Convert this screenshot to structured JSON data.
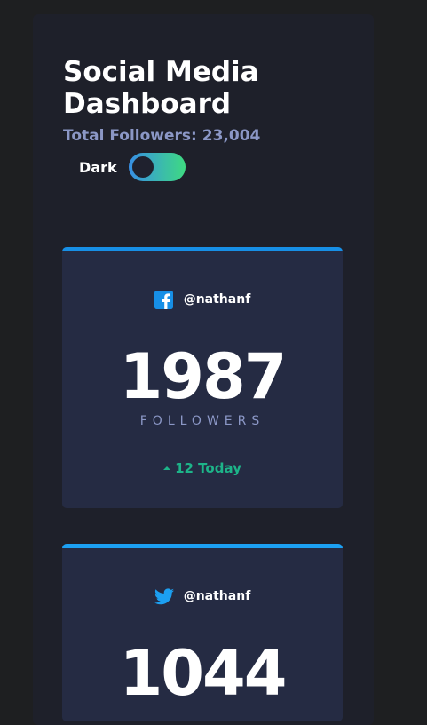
{
  "header": {
    "title": "Social Media Dashboard",
    "total_followers": "Total Followers: 23,004",
    "theme_toggle_label": "Dark"
  },
  "cards": [
    {
      "network": "facebook",
      "icon": "facebook-icon",
      "accent_color": "#178fe6",
      "handle": "@nathanf",
      "count": "1987",
      "count_label": "FOLLOWERS",
      "today_change": "12 Today",
      "today_trend": "up"
    },
    {
      "network": "twitter",
      "icon": "twitter-icon",
      "accent_color": "#1ca0f2",
      "handle": "@nathanf",
      "count": "1044"
    }
  ],
  "colors": {
    "page_background": "#1e1f21",
    "panel_background": "#1e202a",
    "card_background": "#252b43",
    "muted_text": "#8b97c6",
    "positive": "#1db489",
    "toggle_gradient_start": "#378fe6",
    "toggle_gradient_end": "#3eda82"
  }
}
